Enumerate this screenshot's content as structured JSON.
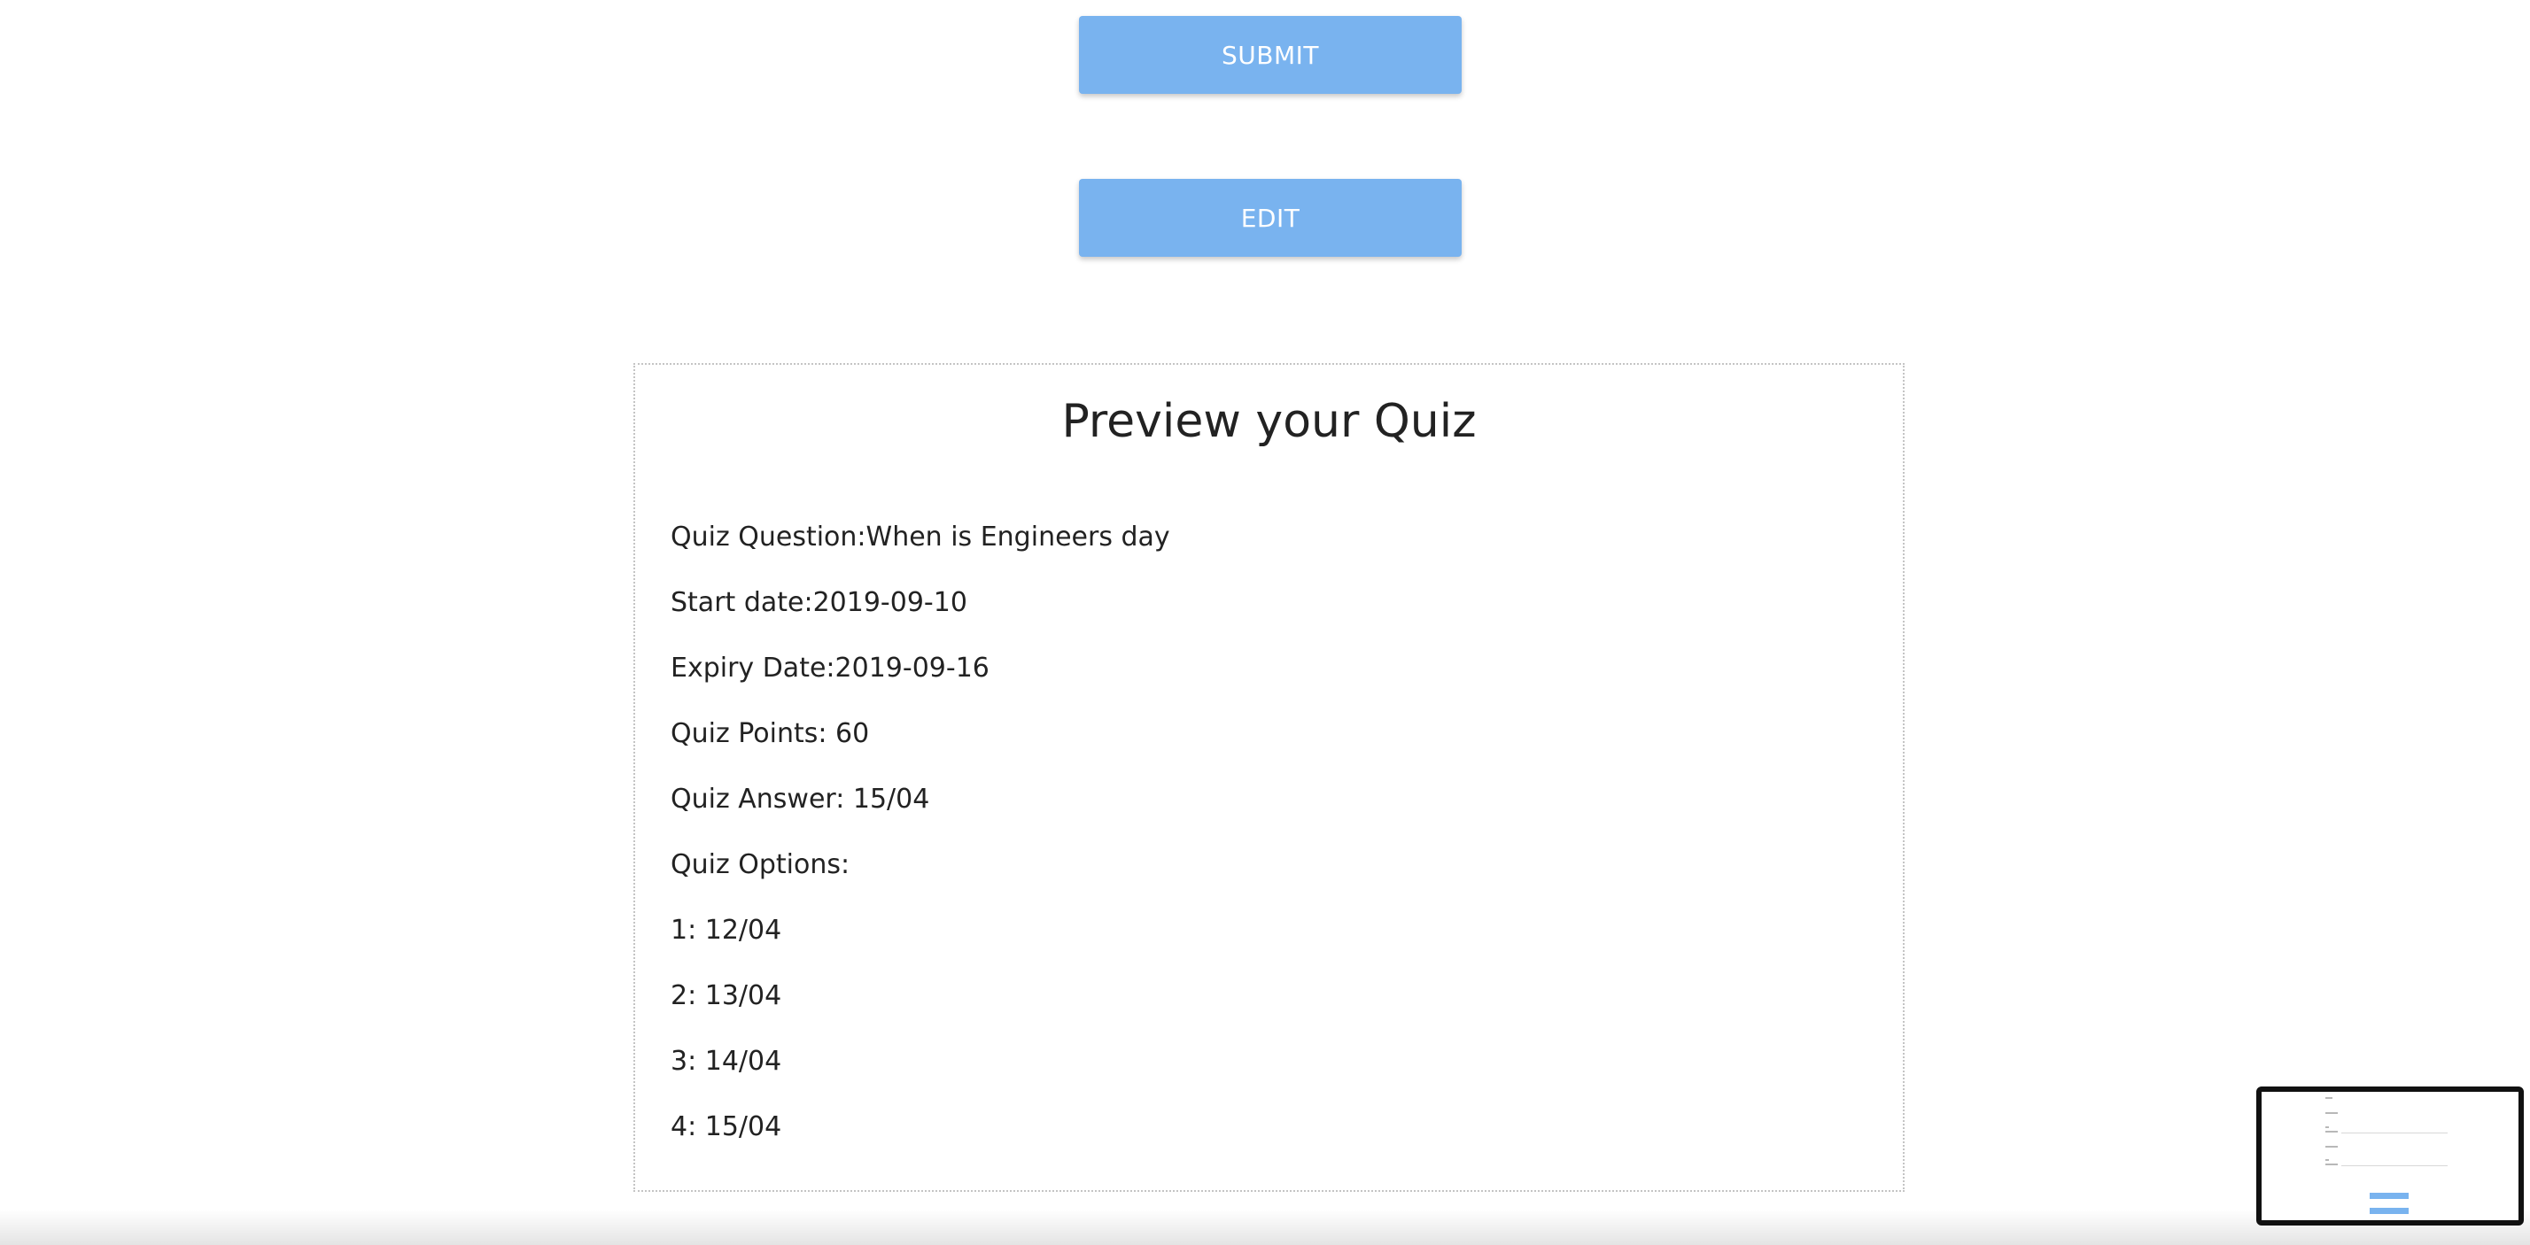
{
  "buttons": {
    "submit_label": "SUBMIT",
    "edit_label": "EDIT"
  },
  "preview": {
    "title": "Preview your Quiz",
    "question": "Quiz Question:When is Engineers day",
    "start_date": "Start date:2019-09-10",
    "expiry_date": "Expiry Date:2019-09-16",
    "points": "Quiz Points: 60",
    "answer": "Quiz Answer: 15/04",
    "options_heading": "Quiz Options:",
    "options": [
      "1: 12/04",
      "2: 13/04",
      "3: 14/04",
      "4: 15/04"
    ]
  },
  "colors": {
    "button_bg": "#79b3ef",
    "button_text": "#ffffff",
    "text": "#222222",
    "preview_border": "#c4c4c4",
    "thumbnail_border": "#111111"
  }
}
